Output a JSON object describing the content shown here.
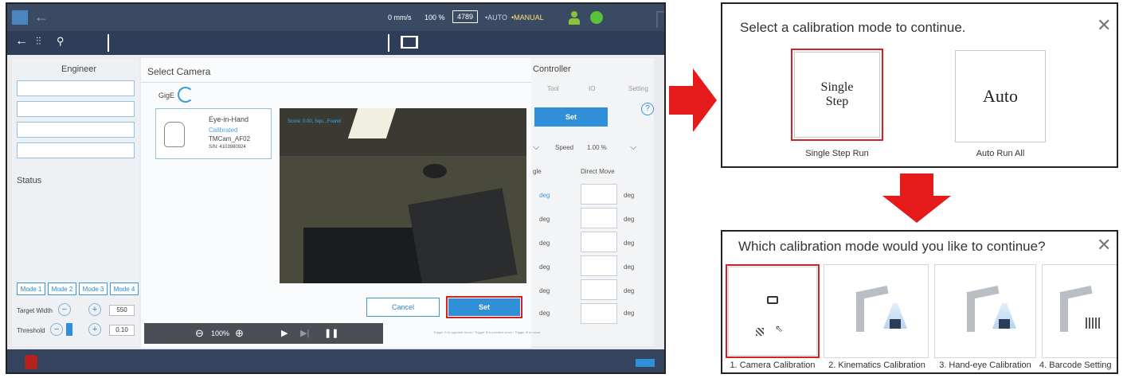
{
  "tm": {
    "speed_readout": "0 mm/s",
    "speed_percent": "100 %",
    "counter": "4789",
    "auto_label": "•AUTO",
    "manual_label": "•MANUAL",
    "engineer": "Engineer",
    "status": "Status",
    "select_camera": "Select Camera",
    "interface": "GigE",
    "camera": {
      "name": "Eye-in-Hand",
      "state": "Calibrated",
      "model": "TMCam_AF02",
      "serial": "S/N: 4103980924"
    },
    "overlay_text": "Score: 0.00, Squ...Found",
    "modes": [
      "Mode 1",
      "Mode 2",
      "Mode 3",
      "Mode 4"
    ],
    "target_width_label": "Target Width",
    "target_width_value": "550",
    "threshold_label": "Threshold",
    "threshold_value": "0.10",
    "zoom": "100%",
    "cancel": "Cancel",
    "set": "Set",
    "controller_title": "Controller",
    "controller_tabs": [
      "Tool",
      "IO",
      "Setting"
    ],
    "controller_set": "Set",
    "help": "?",
    "speed_label": "Speed",
    "speed_value": "1.00 %",
    "col_angle": "gle",
    "col_direct": "Direct Move",
    "unit": "deg",
    "footer_hint": "Trigger ⊖ to opposite move  /  Trigger ⊕ to positive move  /  Trigger ⊕ to move",
    "accent": "#2f8fd8",
    "header_bg": "#3a4a63"
  },
  "dialog1": {
    "title": "Select a calibration mode to continue.",
    "single_text_1": "Single",
    "single_text_2": "Step",
    "single_caption": "Single Step Run",
    "auto_text": "Auto",
    "auto_caption": "Auto Run All"
  },
  "dialog2": {
    "title": "Which calibration mode would you like to continue?",
    "cards": [
      "1. Camera Calibration",
      "2. Kinematics Calibration",
      "3. Hand-eye Calibration",
      "4. Barcode Setting"
    ]
  },
  "highlight_color": "#d41f26"
}
